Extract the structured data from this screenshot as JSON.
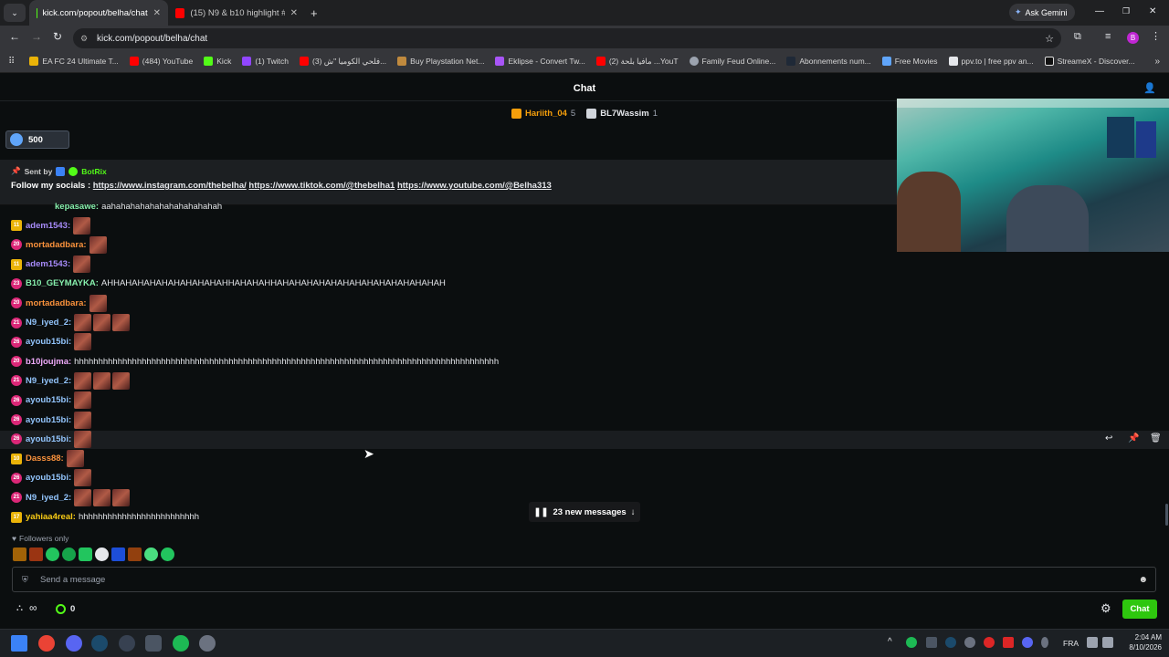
{
  "browser": {
    "tabs": [
      {
        "title": "kick.com/popout/belha/chat",
        "active": true
      },
      {
        "title": "(15) N9 & b10 highlight #1 - Yo",
        "active": false
      }
    ],
    "new_tab": "+",
    "ask_gemini": "Ask Gemini",
    "url": "kick.com/popout/belha/chat",
    "profile_initial": "B",
    "bookmarks": [
      "EA FC 24 Ultimate T...",
      "(484) YouTube",
      "Kick",
      "(1) Twitch",
      "(3) فلحي الكوميا \"ش...",
      "Buy Playstation Net...",
      "Eklipse - Convert Tw...",
      "(2) مافيا بلحة ...YouT",
      "Family Feud Online...",
      "Abonnements num...",
      "Free Movies",
      "ppv.to | free ppv an...",
      "StreameX - Discover..."
    ]
  },
  "chat": {
    "header": "Chat",
    "leaders": [
      {
        "name": "Hariith_04",
        "count": "5",
        "color": "#f59e0b"
      },
      {
        "name": "BL7Wassim",
        "count": "1",
        "color": "#e5e7eb"
      }
    ],
    "goal": "500",
    "pinned": {
      "sent_by_label": "Sent by",
      "sender": "BotRix",
      "text": "Follow my socials :",
      "links": [
        "https://www.instagram.com/thebelha/",
        "https://www.tiktok.com/@thebelha1",
        "https://www.youtube.com/@Belha313"
      ]
    },
    "partial_top": {
      "user": "kepasawe:",
      "text": "aahahahahahahahahahahahah"
    },
    "messages": [
      {
        "badge": "11",
        "user": "adem1543:",
        "color": "#a78bfa",
        "text": "",
        "emotes": 1
      },
      {
        "badge": "20",
        "user": "mortadadbara:",
        "color": "#fb923c",
        "text": "",
        "emotes": 1
      },
      {
        "badge": "11",
        "user": "adem1543:",
        "color": "#a78bfa",
        "text": "",
        "emotes": 1
      },
      {
        "badge": "23",
        "user": "B10_GEYMAYKA:",
        "color": "#86efac",
        "text": "AHHAHAHAHAHAHAHAHAHAHHAHAHAHHAHAHAHAHAHAHAHAHAHAHAHAHAHAH",
        "emotes": 0
      },
      {
        "badge": "20",
        "user": "mortadadbara:",
        "color": "#fb923c",
        "text": "",
        "emotes": 1
      },
      {
        "badge": "21",
        "user": "N9_iyed_2:",
        "color": "#93c5fd",
        "text": "",
        "emotes": 3
      },
      {
        "badge": "26",
        "user": "ayoub15bi:",
        "color": "#93c5fd",
        "text": "",
        "emotes": 1
      },
      {
        "badge": "20",
        "user": "b10joujma:",
        "color": "#f0abfc",
        "text": "hhhhhhhhhhhhhhhhhhhhhhhhhhhhhhhhhhhhhhhhhhhhhhhhhhhhhhhhhhhhhhhhhhhhhhhhhhhhhhhhhhhhhhhh",
        "emotes": 0
      },
      {
        "badge": "21",
        "user": "N9_iyed_2:",
        "color": "#93c5fd",
        "text": "",
        "emotes": 3
      },
      {
        "badge": "26",
        "user": "ayoub15bi:",
        "color": "#93c5fd",
        "text": "",
        "emotes": 1
      },
      {
        "badge": "26",
        "user": "ayoub15bi:",
        "color": "#93c5fd",
        "text": "",
        "emotes": 1
      },
      {
        "badge": "26",
        "user": "ayoub15bi:",
        "color": "#93c5fd",
        "text": "",
        "emotes": 1
      },
      {
        "badge": "10",
        "user": "Dasss88:",
        "color": "#fb923c",
        "text": "",
        "emotes": 1
      },
      {
        "badge": "26",
        "user": "ayoub15bi:",
        "color": "#93c5fd",
        "text": "",
        "emotes": 1
      },
      {
        "badge": "21",
        "user": "N9_iyed_2:",
        "color": "#93c5fd",
        "text": "",
        "emotes": 3
      },
      {
        "badge": "17",
        "user": "yahiaa4real:",
        "color": "#facc15",
        "text": "hhhhhhhhhhhhhhhhhhhhhhhhh",
        "emotes": 0
      }
    ],
    "new_messages": "23 new messages",
    "followers_only": "Followers only",
    "input_placeholder": "Send a message",
    "infinity": "∞",
    "points": "0",
    "chat_button": "Chat"
  },
  "taskbar": {
    "lang": "FRA",
    "time": "2:04 AM",
    "date": "8/10/2026"
  },
  "colors": {
    "kick_green": "#53fc18",
    "background": "#0b0e0f"
  }
}
